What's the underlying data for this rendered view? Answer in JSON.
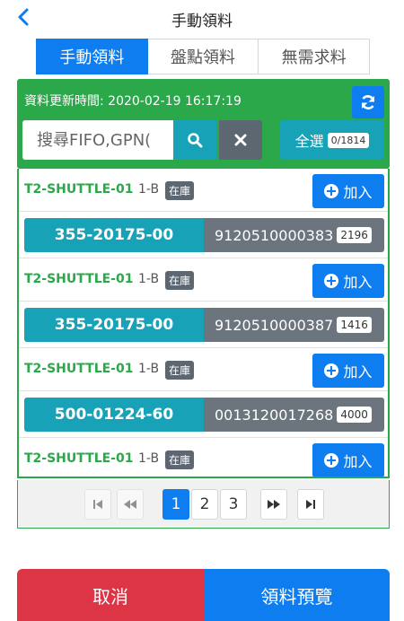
{
  "header": {
    "title": "手動領料",
    "back_icon": "chevron-left-icon"
  },
  "tabs": [
    {
      "label": "手動領料",
      "active": true
    },
    {
      "label": "盤點領料",
      "active": false
    },
    {
      "label": "無需求料",
      "active": false
    }
  ],
  "filter": {
    "updated_text": "資料更新時間: 2020-02-19 16:17:19",
    "search_placeholder": "搜尋FIFO,GPN(",
    "select_all_label": "全選",
    "selected_count": "0/1814"
  },
  "items": [
    {
      "station": "T2-SHUTTLE-01",
      "location": "1-B",
      "stock_status": "在庫",
      "add_label": "加入",
      "part": "355-20175-00",
      "lot": "9120510000383",
      "qty": "2196"
    },
    {
      "station": "T2-SHUTTLE-01",
      "location": "1-B",
      "stock_status": "在庫",
      "add_label": "加入",
      "part": "355-20175-00",
      "lot": "9120510000387",
      "qty": "1416"
    },
    {
      "station": "T2-SHUTTLE-01",
      "location": "1-B",
      "stock_status": "在庫",
      "add_label": "加入",
      "part": "500-01224-60",
      "lot": "0013120017268",
      "qty": "4000"
    },
    {
      "station": "T2-SHUTTLE-01",
      "location": "1-B",
      "stock_status": "在庫",
      "add_label": "加入"
    }
  ],
  "pagination": {
    "pages": [
      "1",
      "2",
      "3"
    ],
    "current": "1"
  },
  "footer": {
    "cancel_label": "取消",
    "preview_label": "領料預覽"
  },
  "colors": {
    "primary": "#0d7df0",
    "success": "#2aa84a",
    "info": "#17a2b8",
    "secondary": "#6c757d",
    "danger": "#dc3545"
  }
}
